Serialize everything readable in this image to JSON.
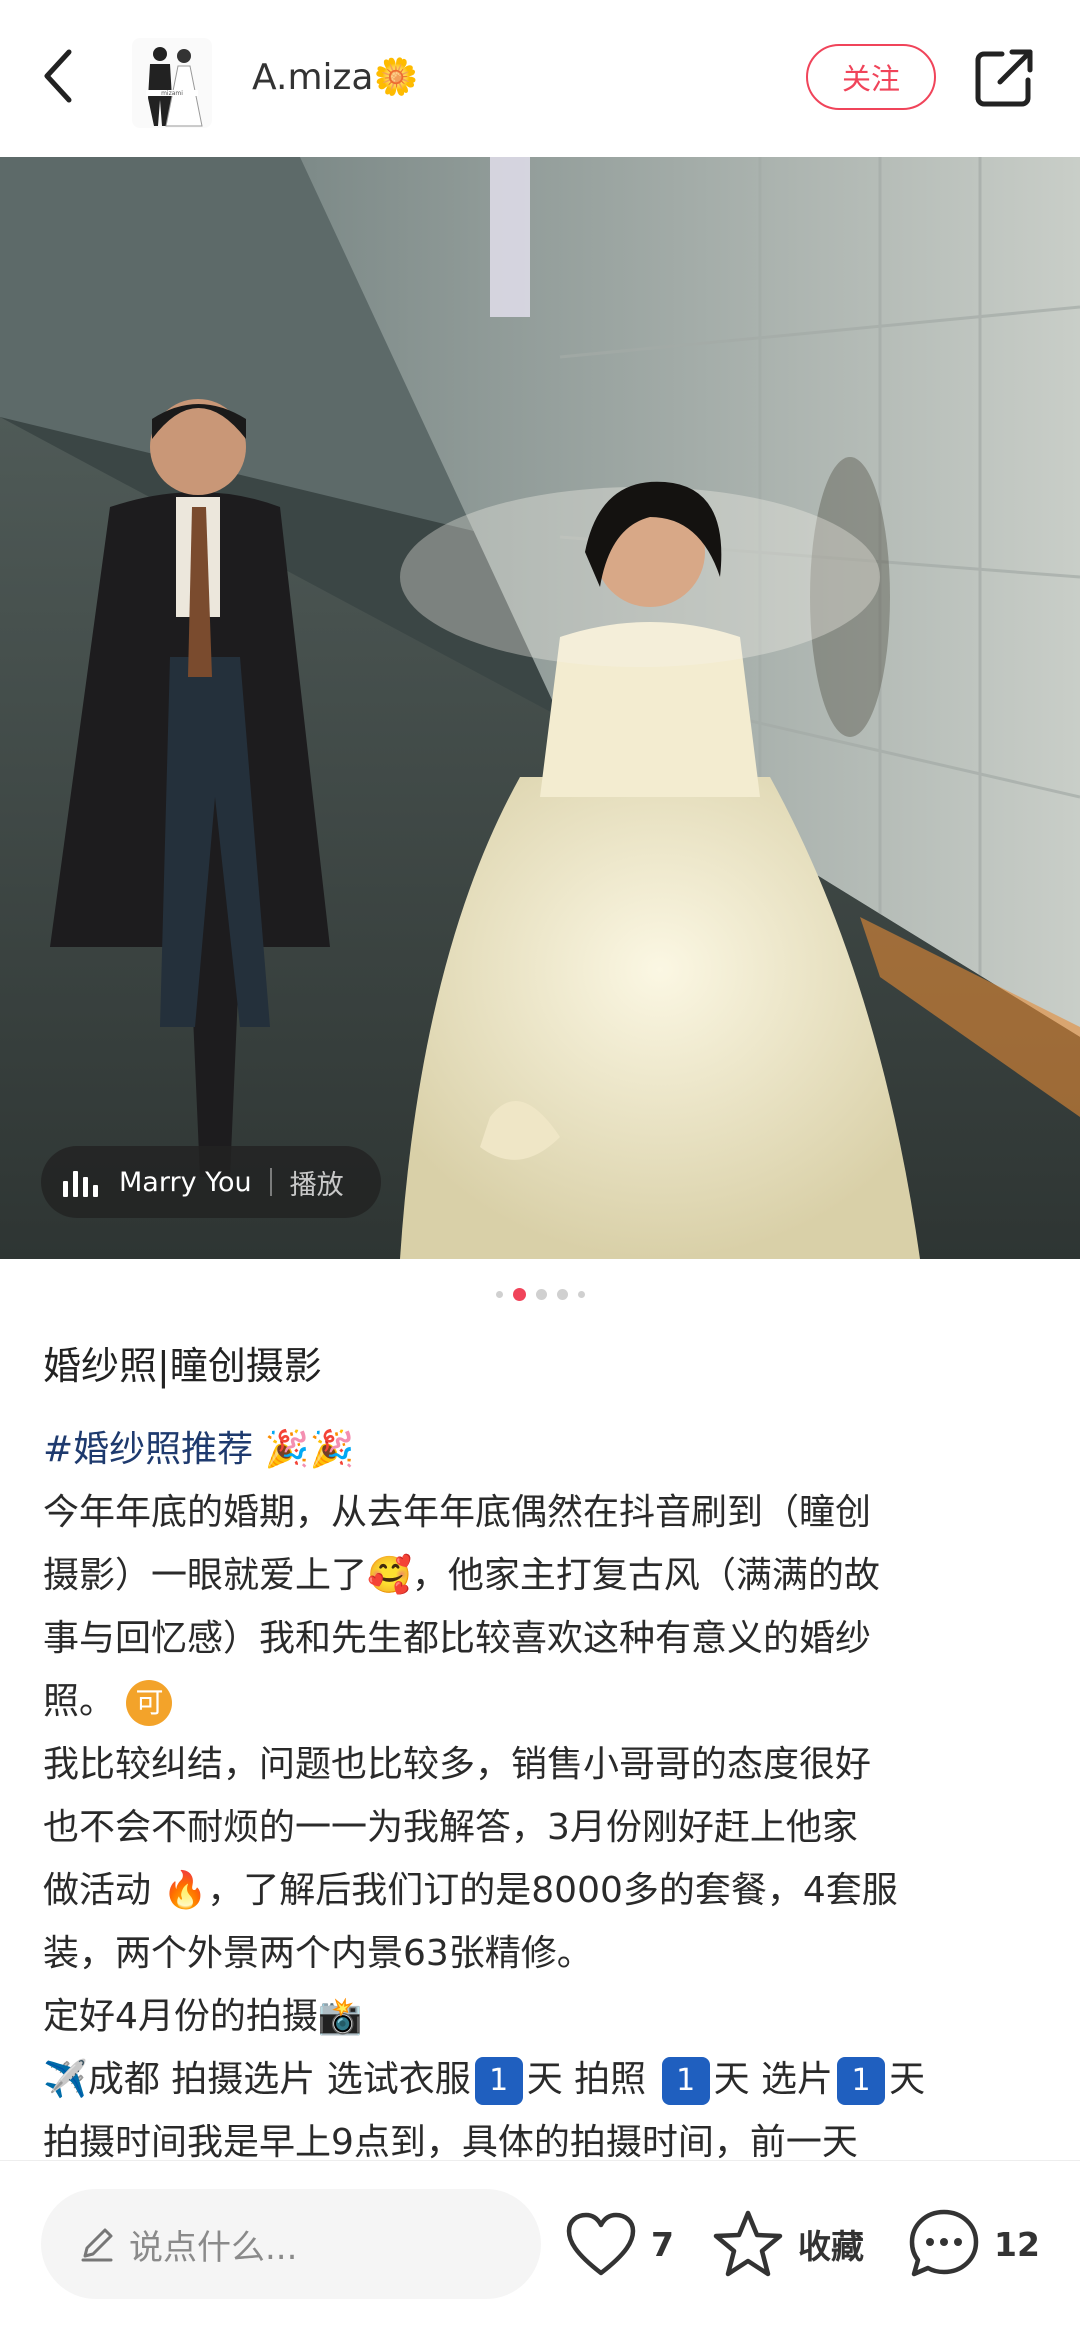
{
  "header": {
    "author_name": "A.miza🌼",
    "follow_label": "关注"
  },
  "music": {
    "song": "Marry You",
    "play_label": "播放"
  },
  "pagination": {
    "total": 5,
    "active": 2
  },
  "post": {
    "title": "婚纱照|瞳创摄影",
    "hashtag": "#婚纱照推荐",
    "hashtag_emoji": "🎉🎉",
    "line1": "今年年底的婚期，从去年年底偶然在抖音刷到（瞳创",
    "line2a": "摄影）一眼就爱上了",
    "line2_emoji": "🥰",
    "line2b": "，他家主打复古风（满满的故",
    "line3": "事与回忆感）我和先生都比较喜欢这种有意义的婚纱",
    "line4": "照。",
    "line4_badge": "可",
    "line5": "我比较纠结，问题也比较多，销售小哥哥的态度很好",
    "line6": "也不会不耐烦的一一为我解答，3月份刚好赶上他家",
    "line7a": "做活动 ",
    "line7_emoji": "🔥",
    "line7b": "，了解后我们订的是8000多的套餐，4套服",
    "line8": "装，两个外景两个内景63张精修。",
    "line9": "定好4月份的拍摄",
    "line9_emoji": "📸",
    "line10_emoji": "✈️",
    "line10a": "成都 拍摄选片 选试衣服",
    "line10_num": "1",
    "line10b": "天 拍照 ",
    "line10c": "天 选片",
    "line10d": "天",
    "line11": "拍摄时间我是早上9点到，具体的拍摄时间，前一天"
  },
  "bottom": {
    "comment_placeholder": "说点什么...",
    "likes": "7",
    "collect_label": "收藏",
    "comments": "12"
  },
  "colors": {
    "accent": "#f0445a",
    "hashtag": "#1e3a6e"
  }
}
